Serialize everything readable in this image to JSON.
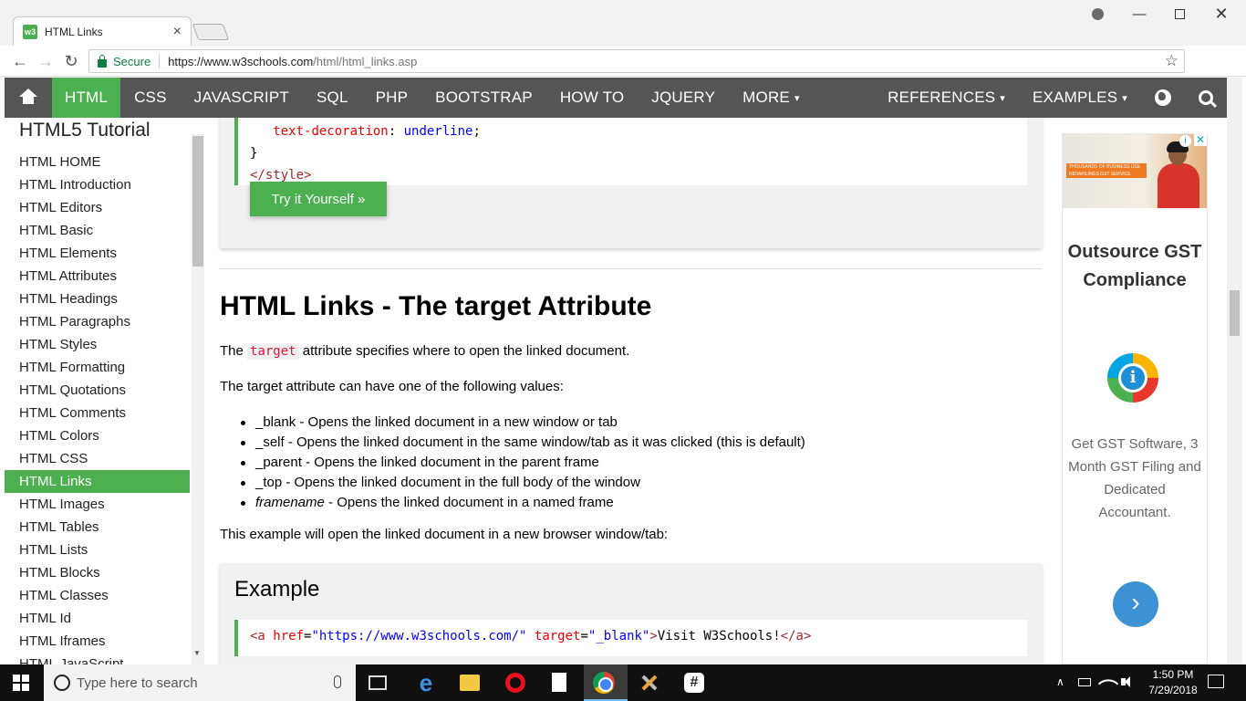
{
  "browser": {
    "tab_title": "HTML Links",
    "tab_favicon": "w3",
    "tab_close": "×",
    "secure_label": "Secure",
    "url_host": "https://www.w3schools.com",
    "url_path": "/html/html_links.asp",
    "back": "←",
    "forward": "→",
    "reload": "↻",
    "star": "☆",
    "menu": "⋮",
    "win_min": "—",
    "win_close": "✕"
  },
  "topnav": {
    "items": [
      {
        "label": "HTML"
      },
      {
        "label": "CSS"
      },
      {
        "label": "JAVASCRIPT"
      },
      {
        "label": "SQL"
      },
      {
        "label": "PHP"
      },
      {
        "label": "BOOTSTRAP"
      },
      {
        "label": "HOW TO"
      },
      {
        "label": "JQUERY"
      },
      {
        "label": "MORE"
      }
    ],
    "right_items": [
      {
        "label": "REFERENCES"
      },
      {
        "label": "EXAMPLES"
      }
    ],
    "caret": "▾"
  },
  "sidebar": {
    "title": "HTML5 Tutorial",
    "items": [
      {
        "label": "HTML HOME"
      },
      {
        "label": "HTML Introduction"
      },
      {
        "label": "HTML Editors"
      },
      {
        "label": "HTML Basic"
      },
      {
        "label": "HTML Elements"
      },
      {
        "label": "HTML Attributes"
      },
      {
        "label": "HTML Headings"
      },
      {
        "label": "HTML Paragraphs"
      },
      {
        "label": "HTML Styles"
      },
      {
        "label": "HTML Formatting"
      },
      {
        "label": "HTML Quotations"
      },
      {
        "label": "HTML Comments"
      },
      {
        "label": "HTML Colors"
      },
      {
        "label": "HTML CSS"
      },
      {
        "label": "HTML Links"
      },
      {
        "label": "HTML Images"
      },
      {
        "label": "HTML Tables"
      },
      {
        "label": "HTML Lists"
      },
      {
        "label": "HTML Blocks"
      },
      {
        "label": "HTML Classes"
      },
      {
        "label": "HTML Id"
      },
      {
        "label": "HTML Iframes"
      },
      {
        "label": "HTML JavaScript"
      }
    ],
    "active_index": 14,
    "scroll_down": "▼"
  },
  "main": {
    "top_code": {
      "line1_prop": "text-decoration",
      "line1_colon": ": ",
      "line1_val": "underline",
      "line1_end": ";",
      "line2": "}",
      "line3": "</style>"
    },
    "try_button": "Try it Yourself »",
    "heading": "HTML Links - The target Attribute",
    "p1_before": "The ",
    "p1_code": "target",
    "p1_after": " attribute specifies where to open the linked document.",
    "p2": "The target attribute can have one of the following values:",
    "values": [
      {
        "name": "_blank",
        "desc": " - Opens the linked document in a new window or tab"
      },
      {
        "name": "_self",
        "desc": " - Opens the linked document in the same window/tab as it was clicked (this is default)"
      },
      {
        "name": "_parent",
        "desc": " - Opens the linked document in the parent frame"
      },
      {
        "name": "_top",
        "desc": " - Opens the linked document in the full body of the window"
      },
      {
        "name": "framename",
        "desc": " - Opens the linked document in a named frame"
      }
    ],
    "p3": "This example will open the linked document in a new browser window/tab:",
    "example_heading": "Example",
    "example_code": {
      "open_tag": "<a",
      "attr1": " href",
      "eq1": "=",
      "val1": "\"https://www.w3schools.com/\"",
      "attr2": " target",
      "eq2": "=",
      "val2": "\"_blank\"",
      "close_open": ">",
      "text": "Visit W3Schools!",
      "close_tag": "</a>"
    }
  },
  "ad": {
    "banner_text": "THOUSANDS OF BUSINESS USE INDIAFILINGS GST SERVICE",
    "adchoice": "i",
    "close": "✕",
    "headline": "Outsource GST Compliance",
    "logo_letter": "i",
    "body": "Get GST Software, 3 Month GST Filing and Dedicated Accountant.",
    "cta": "›"
  },
  "taskbar": {
    "search_placeholder": "Type here to search",
    "time": "1:50 PM",
    "date": "7/29/2018",
    "tray_chevron": "∧",
    "slack_glyph": "#"
  },
  "colors": {
    "w3_green": "#4caf50",
    "nav_bg": "#555555",
    "code_red": "#ff0000",
    "code_blue": "#0000ff",
    "code_tag": "#a52a2a",
    "taskbar_bg": "#101010"
  },
  "icons": [
    "home-icon",
    "globe-icon",
    "search-icon",
    "lock-icon",
    "star-icon",
    "windows-start-icon",
    "chrome-icon",
    "edge-icon",
    "opera-icon",
    "file-explorer-icon",
    "slack-icon"
  ]
}
